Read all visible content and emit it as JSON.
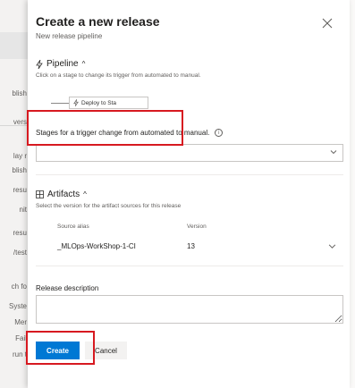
{
  "background": {
    "items": [
      "blish",
      "vers",
      "lay r",
      "blish",
      "resu",
      "nit",
      "resu",
      "/test",
      "ch fo",
      "Syste",
      "Mer",
      "Fail",
      "run t"
    ]
  },
  "dialog": {
    "title": "Create a new release",
    "subtitle": "New release pipeline",
    "close_icon": "close-icon"
  },
  "pipeline": {
    "heading": "Pipeline",
    "heading_icon": "lightning-icon",
    "hint": "Click on a stage to change its trigger from automated to manual.",
    "stage_chip_label": "Deploy to Sta",
    "stage_chip_icon": "lightning-icon"
  },
  "stages": {
    "label": "Stages for a trigger change from automated to manual.",
    "info_icon": "info-icon",
    "dropdown_value": ""
  },
  "artifacts": {
    "heading": "Artifacts",
    "heading_icon": "artifacts-icon",
    "hint": "Select the version for the artifact sources for this release",
    "columns": {
      "source_alias": "Source alias",
      "version": "Version"
    },
    "rows": [
      {
        "alias": "_MLOps-WorkShop-1-CI",
        "version": "13"
      }
    ]
  },
  "release_description": {
    "label": "Release description",
    "value": ""
  },
  "actions": {
    "create_label": "Create",
    "cancel_label": "Cancel"
  },
  "colors": {
    "primary": "#0078d4",
    "annotation": "#d71920"
  }
}
